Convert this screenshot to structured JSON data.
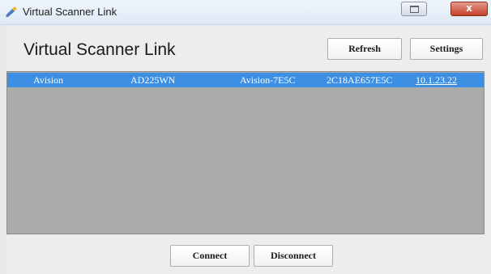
{
  "window": {
    "title": "Virtual Scanner Link",
    "close_glyph": "x"
  },
  "header": {
    "heading": "Virtual Scanner Link",
    "refresh_label": "Refresh",
    "settings_label": "Settings"
  },
  "scanner_list": {
    "rows": [
      {
        "vendor": "Avision",
        "model": "AD225WN",
        "device_name": "Avision-7E5C",
        "mac": "2C18AE657E5C",
        "ip": "10.1.23.22",
        "selected": true
      }
    ]
  },
  "footer": {
    "connect_label": "Connect",
    "disconnect_label": "Disconnect"
  },
  "colors": {
    "selection": "#3d8fe3",
    "list_background": "#ababab",
    "close_button": "#c6402b"
  },
  "icons": {
    "app": "scanner-link-icon",
    "restore": "restore-icon",
    "close": "close-icon"
  }
}
